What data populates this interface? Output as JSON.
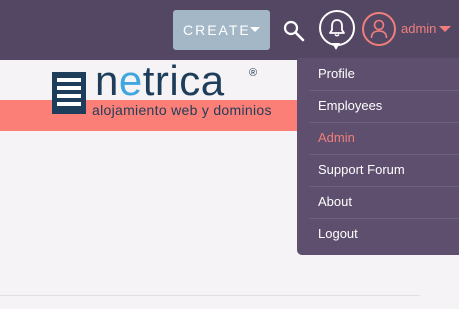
{
  "header": {
    "create_label": "CREATE",
    "user_name": "admin"
  },
  "logo": {
    "text_n": "n",
    "text_e": "e",
    "text_rest": "trica",
    "registered": "®",
    "tagline": "alojamiento web y dominios"
  },
  "user_menu": {
    "items": [
      "Profile",
      "Employees",
      "Admin",
      "Support Forum",
      "About",
      "Logout"
    ],
    "active_item": "Admin"
  },
  "colors": {
    "topbar": "#544764",
    "menu_bg": "#5d4f6d",
    "accent": "#f07f7b",
    "create_btn": "#a4b7c6",
    "banner": "#fb7f77"
  },
  "icons": [
    "search-icon",
    "bell-icon",
    "user-avatar-icon",
    "chevron-down-icon"
  ]
}
